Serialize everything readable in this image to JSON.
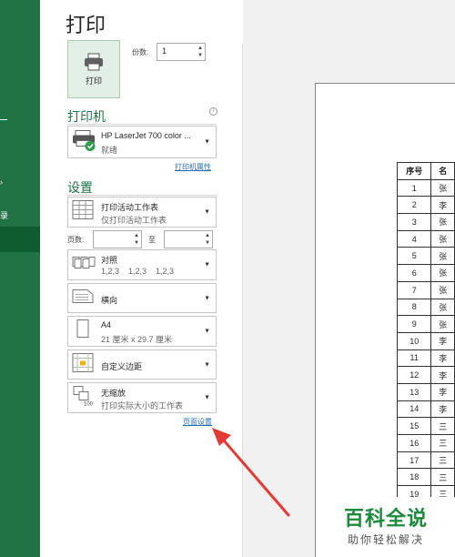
{
  "sidebar": {
    "items": [
      {
        "label": "录"
      }
    ]
  },
  "page": {
    "title": "打印"
  },
  "print_button": {
    "label": "打印"
  },
  "copies": {
    "label": "份数:",
    "value": "1"
  },
  "printer": {
    "section": "打印机",
    "name": "HP LaserJet 700 color ...",
    "status": "就绪",
    "properties_link": "打印机属性"
  },
  "settings": {
    "section": "设置",
    "print_what": {
      "title": "打印活动工作表",
      "subtitle": "仅打印活动工作表"
    },
    "pages": {
      "label": "页数:",
      "to": "至",
      "from_value": "",
      "to_value": ""
    },
    "collate": {
      "title": "对照",
      "subtitle": "1,2,3    1,2,3    1,2,3"
    },
    "orientation": {
      "title": "横向"
    },
    "paper": {
      "title": "A4",
      "subtitle": "21 厘米 x 29.7 厘米"
    },
    "margins": {
      "title": "自定义边距"
    },
    "scaling": {
      "title": "无缩放",
      "subtitle": "打印实际大小的工作表"
    },
    "page_setup_link": "页面设置"
  },
  "preview": {
    "columns": [
      "序号",
      "名"
    ],
    "rows": [
      [
        "1",
        "张"
      ],
      [
        "2",
        "李"
      ],
      [
        "3",
        "张"
      ],
      [
        "4",
        "张"
      ],
      [
        "5",
        "张"
      ],
      [
        "6",
        "张"
      ],
      [
        "7",
        "张"
      ],
      [
        "8",
        "张"
      ],
      [
        "9",
        "张"
      ],
      [
        "10",
        "李"
      ],
      [
        "11",
        "李"
      ],
      [
        "12",
        "李"
      ],
      [
        "13",
        "李"
      ],
      [
        "14",
        "李"
      ],
      [
        "15",
        "三"
      ],
      [
        "16",
        "三"
      ],
      [
        "17",
        "三"
      ],
      [
        "18",
        "三"
      ],
      [
        "19",
        "三"
      ]
    ]
  },
  "watermark": {
    "title": "百科全说",
    "subtitle": "助你轻松解决"
  },
  "colors": {
    "accent": "#217346",
    "arrow": "#e53935",
    "link": "#2a6fb1"
  }
}
